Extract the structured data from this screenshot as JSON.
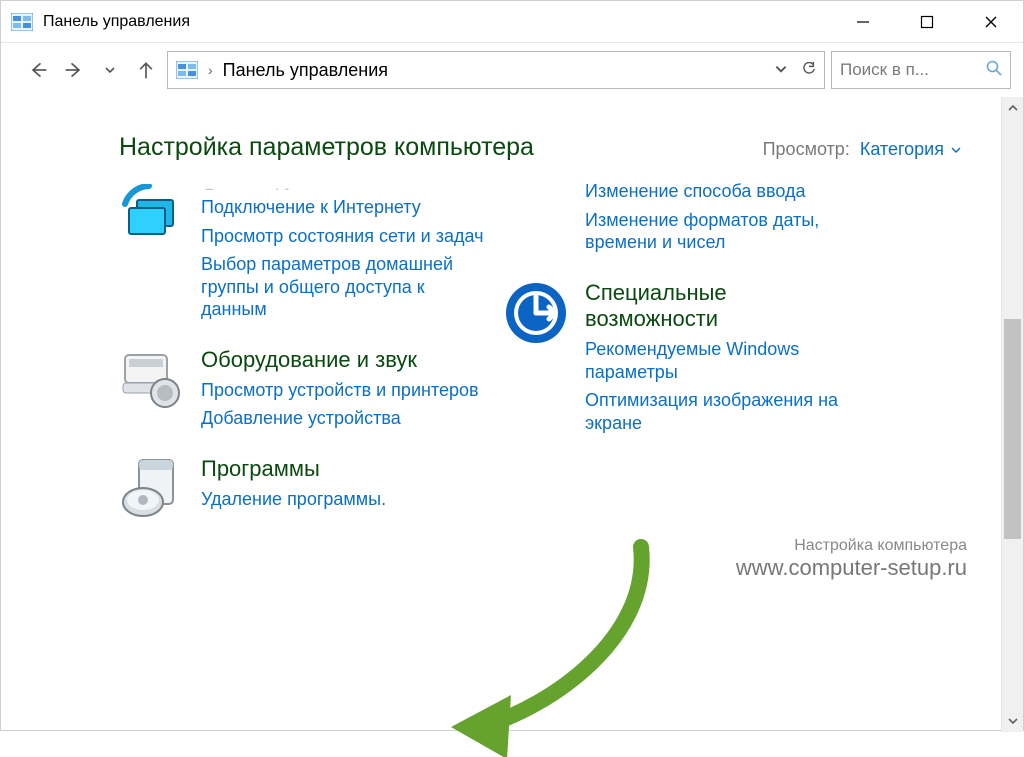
{
  "window": {
    "title": "Панель управления"
  },
  "address": {
    "path": "Панель управления"
  },
  "search": {
    "placeholder": "Поиск в п..."
  },
  "page": {
    "heading": "Настройка параметров компьютера",
    "viewby_label": "Просмотр:",
    "viewby_value": "Категория"
  },
  "left": {
    "c0_title": "Сеть и Интернет",
    "c0_l0": "Подключение к Интернету",
    "c0_l1": "Просмотр состояния сети и задач",
    "c0_l2": "Выбор параметров домашней группы и общего доступа к данным",
    "c1_title": "Оборудование и звук",
    "c1_l0": "Просмотр устройств и принтеров",
    "c1_l1": "Добавление устройства",
    "c2_title": "Программы",
    "c2_l0": "Удаление программы."
  },
  "right": {
    "c0_l0": "Изменение способа ввода",
    "c0_l1": "Изменение форматов даты, времени и чисел",
    "c1_title": "Специальные возможности",
    "c1_l0": "Рекомендуемые Windows параметры",
    "c1_l1": "Оптимизация изображения на экране"
  },
  "watermark": {
    "line1": "Настройка компьютера",
    "line2": "www.computer-setup.ru"
  }
}
